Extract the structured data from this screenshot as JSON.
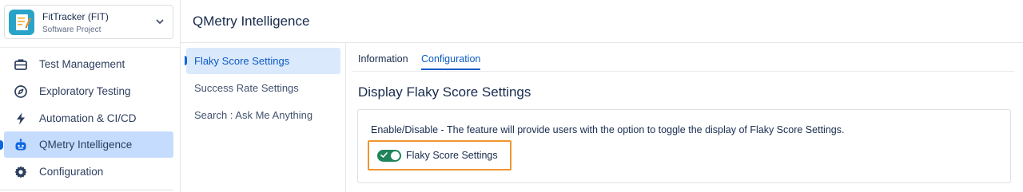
{
  "project": {
    "name": "FitTracker (FIT)",
    "type": "Software Project"
  },
  "sidebar": {
    "items": [
      {
        "label": "Test Management",
        "icon": "briefcase-icon",
        "active": false
      },
      {
        "label": "Exploratory Testing",
        "icon": "compass-icon",
        "active": false
      },
      {
        "label": "Automation & CI/CD",
        "icon": "lightning-icon",
        "active": false
      },
      {
        "label": "QMetry Intelligence",
        "icon": "robot-icon",
        "active": true
      },
      {
        "label": "Configuration",
        "icon": "gear-icon",
        "active": false
      }
    ]
  },
  "header": {
    "title": "QMetry Intelligence"
  },
  "subnav": {
    "items": [
      {
        "label": "Flaky Score Settings",
        "active": true
      },
      {
        "label": "Success Rate Settings",
        "active": false
      },
      {
        "label": "Search : Ask Me Anything",
        "active": false
      }
    ]
  },
  "tabs": [
    {
      "label": "Information",
      "active": false
    },
    {
      "label": "Configuration",
      "active": true
    }
  ],
  "section": {
    "title": "Display Flaky Score Settings",
    "description": "Enable/Disable - The feature will provide users with the option to toggle the display of Flaky Score Settings.",
    "toggle_label": "Flaky Score Settings",
    "toggle_on": true
  },
  "colors": {
    "accent": "#0c66e4",
    "active_nav_bg": "#c5dcff",
    "toggle_on": "#1f845a",
    "highlight_border": "#f0952e"
  }
}
